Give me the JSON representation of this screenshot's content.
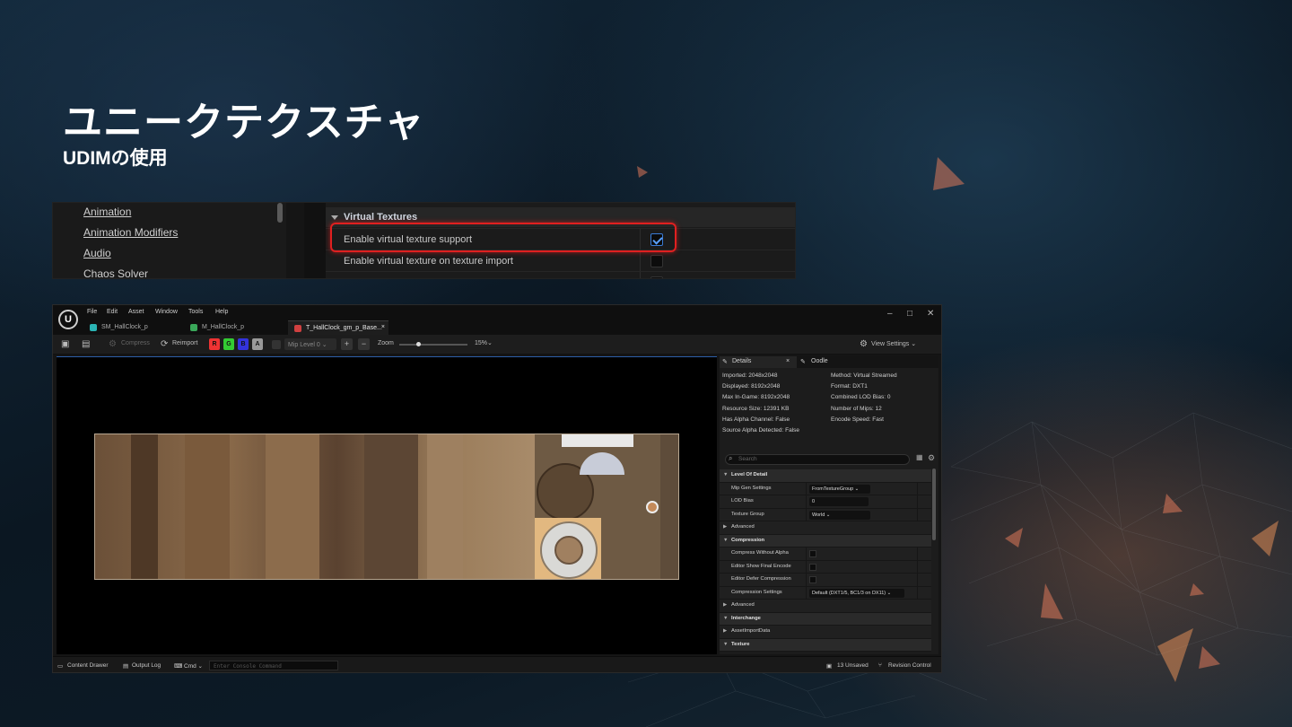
{
  "slide": {
    "title": "ユニークテクスチャ",
    "subtitle": "UDIMの使用"
  },
  "project_settings": {
    "categories": [
      "Animation",
      "Animation Modifiers",
      "Audio",
      "Chaos Solver"
    ],
    "section": "Virtual Textures",
    "rows": [
      {
        "label": "Enable virtual texture support",
        "checked": true
      },
      {
        "label": "Enable virtual texture on texture import",
        "checked": false
      }
    ]
  },
  "ue": {
    "menu": [
      "File",
      "Edit",
      "Asset",
      "Window",
      "Tools",
      "Help"
    ],
    "tabs": [
      {
        "label": "SM_HallClock_p",
        "color": "#2ab3b3"
      },
      {
        "label": "M_HallClock_p",
        "color": "#3aa85a"
      },
      {
        "label": "T_HallClock_gm_p_Base...",
        "color": "#d04040"
      }
    ],
    "window_controls": {
      "minimize": "–",
      "maximize": "□",
      "close": "✕"
    },
    "toolbar": {
      "compress": "Compress",
      "reimport": "Reimport",
      "channels": [
        {
          "label": "R",
          "color": "#e33"
        },
        {
          "label": "G",
          "color": "#3c3"
        },
        {
          "label": "B",
          "color": "#33d"
        },
        {
          "label": "A",
          "color": "#999"
        }
      ],
      "mip": "Mip Level 0",
      "plus": "+",
      "minus": "−",
      "zoom_label": "Zoom",
      "zoom_value": "15%",
      "zoom_level": 0.28,
      "view_settings": "View Settings"
    },
    "details": {
      "tab_details": "Details",
      "tab_close": "×",
      "tab_oodle": "Oodle",
      "info_left": [
        "Imported: 2048x2048",
        "Displayed: 8192x2048",
        "Max In-Game: 8192x2048",
        "Resource Size: 12391 KB",
        "Has Alpha Channel: False",
        "Source Alpha Detected: False"
      ],
      "info_right": [
        "Method: Virtual Streamed",
        "Format: DXT1",
        "Combined LOD Bias: 0",
        "Number of Mips: 12",
        "Encode Speed: Fast"
      ],
      "search_placeholder": "Search",
      "props": [
        {
          "name": "Level Of Detail",
          "type": "section"
        },
        {
          "name": "Mip Gen Settings",
          "type": "dropdown",
          "value": "FromTextureGroup"
        },
        {
          "name": "LOD Bias",
          "type": "input",
          "value": "0"
        },
        {
          "name": "Texture Group",
          "type": "dropdown",
          "value": "World"
        },
        {
          "name": "Advanced",
          "type": "collapsed"
        },
        {
          "name": "Compression",
          "type": "section"
        },
        {
          "name": "Compress Without Alpha",
          "type": "check"
        },
        {
          "name": "Editor Show Final Encode",
          "type": "check"
        },
        {
          "name": "Editor Defer Compression",
          "type": "check"
        },
        {
          "name": "Compression Settings",
          "type": "dropdown",
          "value": "Default (DXT1/5, BC1/3 on DX11)"
        },
        {
          "name": "Advanced",
          "type": "collapsed"
        },
        {
          "name": "Interchange",
          "type": "section"
        },
        {
          "name": "AssetImportData",
          "type": "collapsed"
        },
        {
          "name": "Texture",
          "type": "section"
        }
      ]
    },
    "status": {
      "content_drawer": "Content Drawer",
      "output_log": "Output Log",
      "cmd": "Cmd",
      "console_placeholder": "Enter Console Command",
      "unsaved": "13 Unsaved",
      "revision": "Revision Control"
    }
  }
}
